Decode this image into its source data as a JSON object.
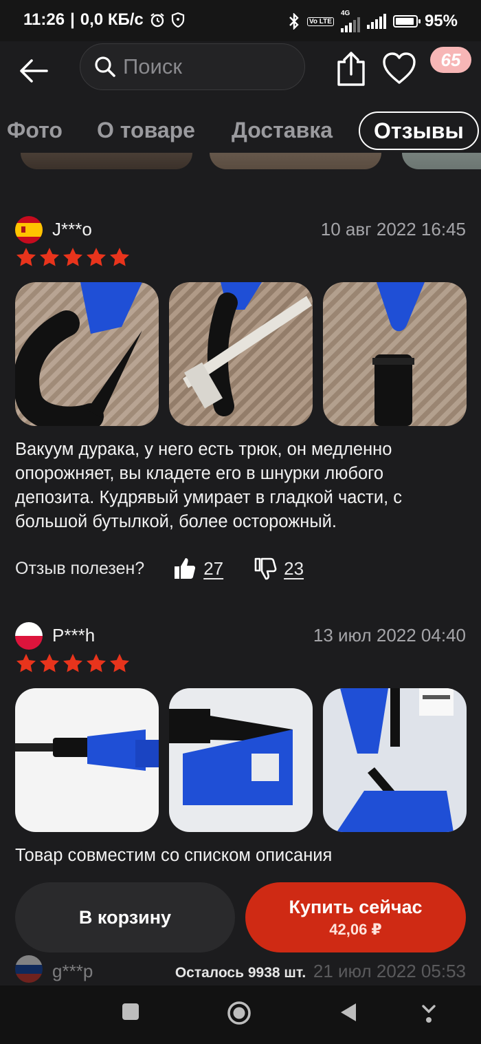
{
  "status_bar": {
    "time": "11:26",
    "net_speed": "0,0 КБ/с",
    "network": "4G",
    "volte": "Vo LTE",
    "battery": "95%"
  },
  "header": {
    "search_placeholder": "Поиск",
    "cart_count": "65"
  },
  "tabs": [
    {
      "label": "Фото",
      "active": false
    },
    {
      "label": "О товаре",
      "active": false
    },
    {
      "label": "Доставка",
      "active": false
    },
    {
      "label": "Отзывы",
      "active": true
    }
  ],
  "reviews": [
    {
      "flag": "spain-flag",
      "author": "J***o",
      "date": "10 авг 2022 16:45",
      "rating": 5,
      "text": "Вакуум дурака, у него есть трюк, он медленно опорожняет, вы кладете его в шнурки любого депозита. Кудрявый умирает в гладкой части, с большой бутылкой, более осторожный.",
      "helpful_label": "Отзыв полезен?",
      "likes": "27",
      "dislikes": "23"
    },
    {
      "flag": "poland-flag",
      "author": "P***h",
      "date": "13 июл 2022 04:40",
      "rating": 5,
      "text": "Товар совместим со списком описания"
    },
    {
      "flag": "russia-flag",
      "author": "g***p",
      "date": "21 июл 2022 05:53"
    }
  ],
  "actions": {
    "cart_label": "В корзину",
    "buy_label": "Купить сейчас",
    "price": "42,06 ₽",
    "remaining": "Осталось 9938 шт."
  },
  "colors": {
    "background": "#1c1c1e",
    "accent": "#cf2a14",
    "star": "#e8341c",
    "badge": "#f7b6b6"
  }
}
